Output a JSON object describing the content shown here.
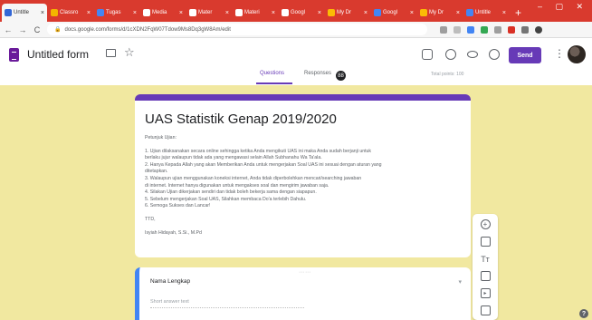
{
  "browser": {
    "tabs": [
      {
        "label": "Untitle",
        "active": true,
        "color": "#3367d6"
      },
      {
        "label": "Classro",
        "active": false,
        "color": "#f4b400"
      },
      {
        "label": "Tugas",
        "active": false,
        "color": "#4285f4"
      },
      {
        "label": "Media",
        "active": false,
        "color": "#ffffff"
      },
      {
        "label": "Mater",
        "active": false,
        "color": "#ffffff"
      },
      {
        "label": "Materi",
        "active": false,
        "color": "#ffffff"
      },
      {
        "label": "Googl",
        "active": false,
        "color": "#ffffff"
      },
      {
        "label": "My Dr",
        "active": false,
        "color": "#fbbc05"
      },
      {
        "label": "Googl",
        "active": false,
        "color": "#4285f4"
      },
      {
        "label": "My Dr",
        "active": false,
        "color": "#fbbc05"
      },
      {
        "label": "Untitle",
        "active": false,
        "color": "#4285f4"
      }
    ],
    "new_tab": "+",
    "url": "docs.google.com/forms/d/1cXDN2FqW07Tdow9Ms8Dq3gW8Am/edit"
  },
  "header": {
    "title": "Untitled form",
    "send_label": "Send"
  },
  "form_tabs": {
    "questions": "Questions",
    "responses": "Responses",
    "response_count": "88",
    "total": "Total points: 100"
  },
  "form": {
    "title": "UAS Statistik Genap 2019/2020",
    "desc_heading": "Petunjuk Ujian:",
    "desc_lines": [
      "1. Ujian dilaksanakan secara online sehingga ketika Anda mengikuti UAS ini maka Anda sudah berjanji untuk",
      "berlaku jujur walaupun tidak ada yang mengawasi selain Allah Subhanahu Wa Ta'ala.",
      "2. Hanya Kepada Allah yang akan Memberikan Anda untuk mengerjakan Soal UAS ini sesuai dengan aturan yang",
      "ditetapkan.",
      "3. Walaupun ujian menggunakan koneksi internet, Anda tidak diperbolehkan mencari/searching jawaban",
      "di internet. Internet hanya digunakan untuk mengakses soal dan mengirim jawaban saja.",
      "4. Silakan Ujian dikerjakan sendiri dan tidak boleh bekerja sama dengan siapapun.",
      "5. Sebelum mengerjakan Soal UAS, Silahkan membaca Do'a terlebih Dahulu.",
      "6. Semoga Sukses dan Lancar!"
    ],
    "signoff": "TTD,",
    "signer": "Isyiah Hidayah, S.Si., M.Pd"
  },
  "question": {
    "label": "Nama Lengkap",
    "placeholder": "Short answer text"
  },
  "tools": [
    "add-question",
    "import",
    "title-text",
    "image",
    "video",
    "section"
  ],
  "colors": {
    "accent": "#673ab7",
    "theme_bg": "#f1e8a0",
    "focus_bar": "#4285f4"
  }
}
